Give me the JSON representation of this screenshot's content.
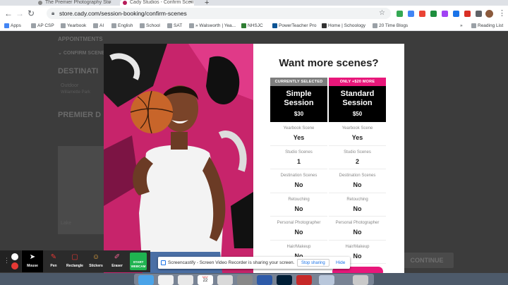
{
  "browser": {
    "tabs": [
      {
        "title": "The Premier Photography Stu",
        "active": false
      },
      {
        "title": "Cady Studios - Confirm Scen",
        "active": true
      }
    ],
    "new_tab": "+",
    "url": "store.cady.com/session-booking/confirm-scenes",
    "bookmarks": [
      "Apps",
      "AP CSP",
      "Yearbook",
      "AI",
      "English",
      "School",
      "SAT",
      "» Walsworth | Yea...",
      "NHSJC",
      "PowerTeacher Pro",
      "Home | Schoology",
      "20 Time Blogs"
    ],
    "more_bookmarks": "»",
    "reading_list": "Reading List"
  },
  "background_page": {
    "appointments": "APPOINTMENTS",
    "confirm_scenes": "CONFIRM SCENES",
    "destination": "DESTINATI",
    "outdoor": "Outdoor",
    "outdoor_sub": "Willamette Park",
    "premier": "PREMIER D",
    "card_label": "Lake",
    "continue": "CONTINUE"
  },
  "modal": {
    "title": "Want more scenes?",
    "columns": [
      {
        "badge": "CURRENTLY SELECTED",
        "name_line1": "Simple",
        "name_line2": "Session",
        "price": "$30",
        "features": [
          {
            "label": "Yearbook Scene",
            "value": "Yes"
          },
          {
            "label": "Studio Scenes",
            "value": "1"
          },
          {
            "label": "Destination Scenes",
            "value": "No"
          },
          {
            "label": "Retouching",
            "value": "No"
          },
          {
            "label": "Personal Photographer",
            "value": "No"
          },
          {
            "label": "Hair/Makeup",
            "value": "No"
          }
        ]
      },
      {
        "badge": "ONLY +$20 MORE",
        "name_line1": "Standard",
        "name_line2": "Session",
        "price": "$50",
        "features": [
          {
            "label": "Yearbook Scene",
            "value": "Yes"
          },
          {
            "label": "Studio Scenes",
            "value": "2"
          },
          {
            "label": "Destination Scenes",
            "value": "No"
          },
          {
            "label": "Retouching",
            "value": "No"
          },
          {
            "label": "Personal Photographer",
            "value": "No"
          },
          {
            "label": "Hair/Makeup",
            "value": "No"
          }
        ]
      }
    ]
  },
  "screencastify": {
    "tools": [
      {
        "label": "Mouse",
        "icon": "cursor-icon",
        "color": "#ffffff"
      },
      {
        "label": "Pen",
        "icon": "pen-icon",
        "color": "#e53935"
      },
      {
        "label": "Rectangle",
        "icon": "rectangle-icon",
        "color": "#e53935"
      },
      {
        "label": "Stickers",
        "icon": "sticker-icon",
        "color": "#f5b042"
      },
      {
        "label": "Eraser",
        "icon": "eraser-icon",
        "color": "#f06292"
      }
    ],
    "webcam_line1": "START",
    "webcam_line2": "WEBCAM",
    "share_text": "Screencastify - Screen Video Recorder is sharing your screen.",
    "stop_sharing": "Stop sharing",
    "hide": "Hide"
  },
  "dock": {
    "calendar_month": "MAY",
    "calendar_day": "22"
  },
  "colors": {
    "accent_pink": "#e8177a",
    "selected_gray": "#7d7d7d",
    "webcam_green": "#1fb350"
  }
}
